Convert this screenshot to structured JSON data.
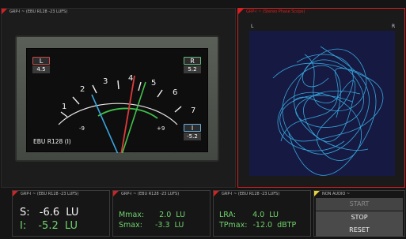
{
  "vu_panel": {
    "title": "GRP-I ~ (EBU R128 -23 LUFS)",
    "meter_name": "EBU R128 (I)",
    "left": {
      "label": "L",
      "value": "4.5"
    },
    "right": {
      "label": "R",
      "value": "5.2"
    },
    "integrated": {
      "label": "I",
      "value": "-5.2"
    },
    "scale": [
      "1",
      "2",
      "3",
      "4",
      "5",
      "6",
      "7"
    ],
    "scale_low": "-9",
    "scale_high": "+9",
    "colors": {
      "needle_red": "#e03a3a",
      "needle_green": "#44c04a",
      "needle_blue": "#3aa6e0",
      "arc": "#e8e8e8",
      "arc_green": "#3fc04a"
    }
  },
  "scope_panel": {
    "title": "GRP-I ~ (Stereo Phase Scope)",
    "left_label": "L",
    "right_label": "R",
    "trace_color": "#38aee6",
    "background": "#161a42"
  },
  "loudness_sl": {
    "title": "GRP-I ~ (EBU R128 -23 LUFS)",
    "s_label": "S:",
    "s_value": "-6.6",
    "s_unit": "LU",
    "i_label": "I:",
    "i_value": "-5.2",
    "i_unit": "LU"
  },
  "loudness_max": {
    "title": "GRP-I ~ (EBU R128 -23 LUFS)",
    "m_label": "Mmax:",
    "m_value": "2.0",
    "m_unit": "LU",
    "s_label": "Smax:",
    "s_value": "-3.3",
    "s_unit": "LU"
  },
  "loudness_lra": {
    "title": "GRP-I ~ (EBU R128 -23 LUFS)",
    "lra_label": "LRA:",
    "lra_value": "4.0",
    "lra_unit": "LU",
    "tp_label": "TPmax:",
    "tp_value": "-12.0",
    "tp_unit": "dBTP"
  },
  "controls": {
    "title": "NON AUDIO ~",
    "start": "START",
    "stop": "STOP",
    "reset": "RESET"
  }
}
